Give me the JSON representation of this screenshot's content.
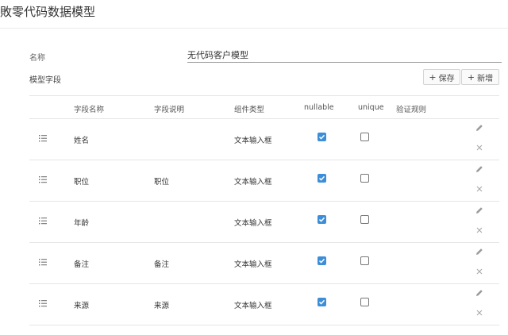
{
  "page": {
    "title": "敗零代码数据模型"
  },
  "form": {
    "name_label": "名称",
    "name_value": "无代码客户模型",
    "fields_label": "模型字段"
  },
  "toolbar": {
    "save_label": "保存",
    "add_label": "新增"
  },
  "table": {
    "columns": {
      "name": "字段名称",
      "desc": "字段说明",
      "component": "组件类型",
      "nullable": "nullable",
      "unique": "unique",
      "validation": "验证规则"
    },
    "rows": [
      {
        "name": "姓名",
        "desc": "",
        "component": "文本输入框",
        "nullable": true,
        "unique": false
      },
      {
        "name": "职位",
        "desc": "职位",
        "component": "文本输入框",
        "nullable": true,
        "unique": false
      },
      {
        "name": "年龄",
        "desc": "",
        "component": "文本输入框",
        "nullable": true,
        "unique": false
      },
      {
        "name": "备注",
        "desc": "备注",
        "component": "文本输入框",
        "nullable": true,
        "unique": false
      },
      {
        "name": "来源",
        "desc": "来源",
        "component": "文本输入框",
        "nullable": true,
        "unique": false
      }
    ]
  },
  "icons": {
    "drag": "drag-handle-icon",
    "edit": "pencil-icon",
    "delete": "close-icon",
    "check": "check-icon"
  },
  "colors": {
    "checkbox_checked": "#3d8ed8",
    "border": "#e6e6e6"
  }
}
